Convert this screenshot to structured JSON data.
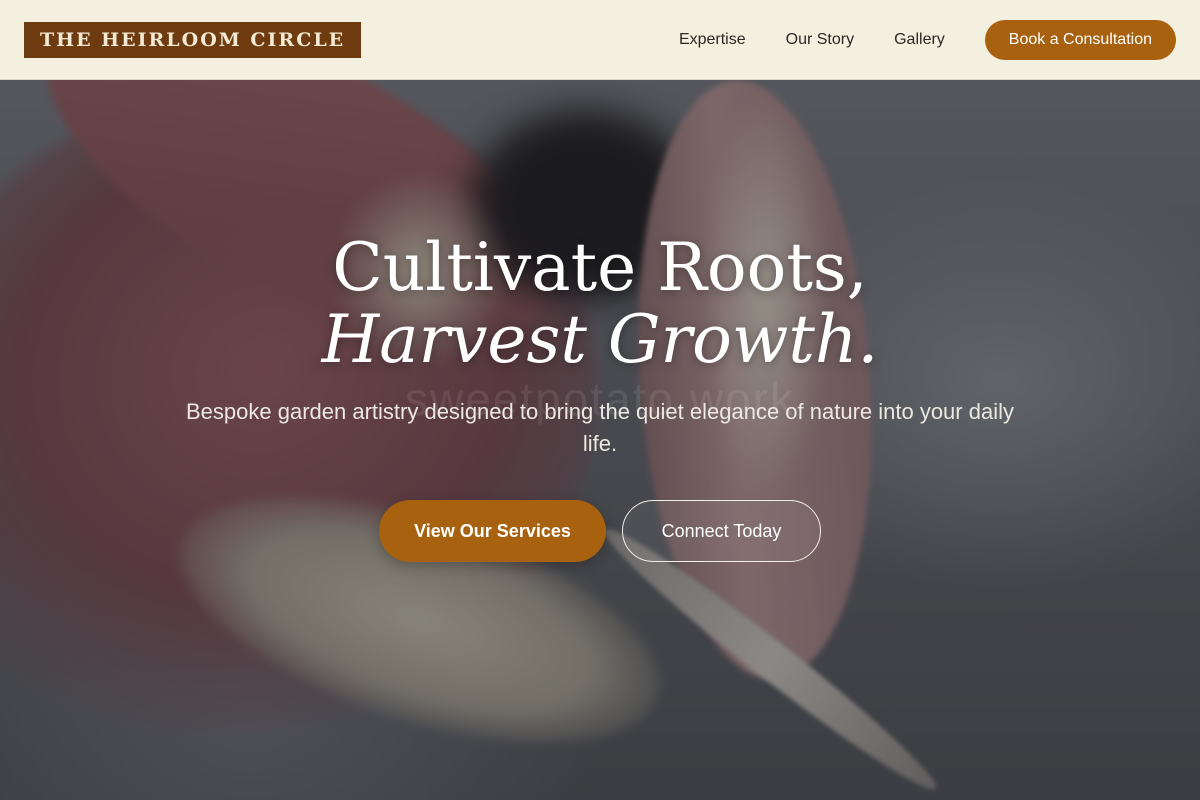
{
  "header": {
    "logo_text": "THE HEIRLOOM CIRCLE",
    "nav_items": [
      {
        "label": "Expertise"
      },
      {
        "label": "Our Story"
      },
      {
        "label": "Gallery"
      }
    ],
    "cta_label": "Book a Consultation"
  },
  "hero": {
    "headline_line1": "Cultivate Roots,",
    "headline_line2": "Harvest Growth.",
    "watermark": "sweetpotato work",
    "subheadline": "Bespoke garden artistry designed to bring the quiet elegance of nature into your daily life.",
    "primary_button": "View Our Services",
    "secondary_button": "Connect Today"
  },
  "colors": {
    "header_bg": "#f3f0e0",
    "logo_bg": "#6e3a0f",
    "accent": "#a8620f",
    "text_light": "#ffffff"
  }
}
